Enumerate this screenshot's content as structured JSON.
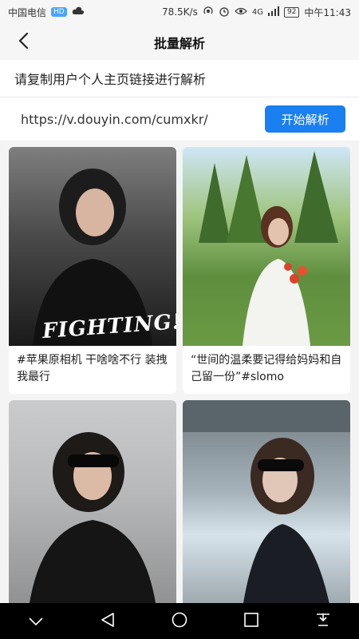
{
  "status_bar": {
    "carrier": "中国电信",
    "hd_badge": "HD",
    "cloud_icon": "cloud-icon",
    "speed": "78.5K/s",
    "signal": "4G",
    "battery": "92",
    "time": "中午11:43"
  },
  "navbar": {
    "title": "批量解析",
    "back_icon": "chevron-left-icon"
  },
  "instruction": "请复制用户个人主页链接进行解析",
  "link_row": {
    "url_value": "https://v.douyin.com/cumxkr/",
    "start_button": "开始解析"
  },
  "videos": [
    {
      "caption": "#苹果原相机 干啥啥不行 装拽我最行",
      "overlay_text": "FIGHTING!"
    },
    {
      "caption": "“世间的温柔要记得给妈妈和自己留一份”#slomo"
    },
    {
      "caption": ""
    },
    {
      "caption": ""
    }
  ],
  "system_nav": {
    "icons": [
      "chevron-down-icon",
      "back-triangle-icon",
      "home-circle-icon",
      "recents-square-icon",
      "notification-pull-icon"
    ]
  },
  "colors": {
    "accent": "#1a7ff0",
    "background": "#f4f4f4",
    "system_nav": "#000000"
  }
}
